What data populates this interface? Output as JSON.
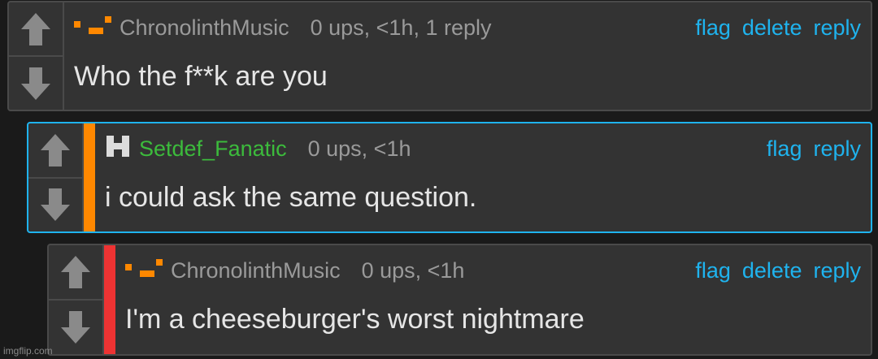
{
  "colors": {
    "link": "#1fb3ee",
    "accent_orange": "#ff8800",
    "accent_red": "#ee3333",
    "username_green": "#3cbb3c"
  },
  "comments": [
    {
      "username": "ChronolinthMusic",
      "user_icon": "orange-dash-icon",
      "stats": "0 ups, <1h, 1 reply",
      "actions": [
        "flag",
        "delete",
        "reply"
      ],
      "text": "Who the f**k are you"
    },
    {
      "username": "Setdef_Fanatic",
      "user_icon": "h-block-icon",
      "stats": "0 ups, <1h",
      "actions": [
        "flag",
        "reply"
      ],
      "text": "i could ask the same question."
    },
    {
      "username": "ChronolinthMusic",
      "user_icon": "orange-dash-icon",
      "stats": "0 ups, <1h",
      "actions": [
        "flag",
        "delete",
        "reply"
      ],
      "text": "I'm a cheeseburger's worst nightmare"
    }
  ],
  "watermark": "imgflip.com"
}
